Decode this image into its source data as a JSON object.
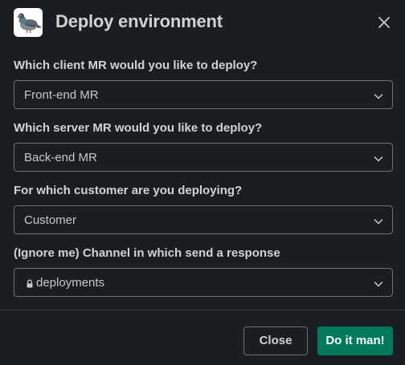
{
  "modal": {
    "title": "Deploy environment",
    "app_icon": "pigeon-icon"
  },
  "fields": [
    {
      "label": "Which client MR would you like to deploy?",
      "value": "Front-end MR"
    },
    {
      "label": "Which server MR would you like to deploy?",
      "value": "Back-end MR"
    },
    {
      "label": "For which customer are you deploying?",
      "value": "Customer"
    },
    {
      "label": "(Ignore me) Channel in which send a response",
      "value": "deployments",
      "icon": "lock-icon"
    }
  ],
  "footer": {
    "close_label": "Close",
    "submit_label": "Do it man!"
  },
  "colors": {
    "background": "#1a1d21",
    "primary": "#007a5a",
    "border": "#6b6e72",
    "text": "#d1d2d3"
  }
}
